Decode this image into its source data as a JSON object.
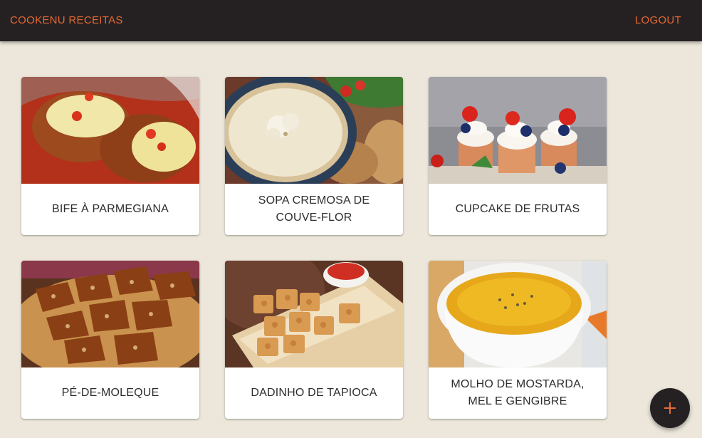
{
  "appbar": {
    "title": "COOKENU RECEITAS",
    "logout_label": "LOGOUT"
  },
  "recipes": [
    {
      "title": "BIFE À PARMEGIANA"
    },
    {
      "title": "SOPA CREMOSA DE COUVE-FLOR"
    },
    {
      "title": "CUPCAKE DE FRUTAS"
    },
    {
      "title": "PÉ-DE-MOLEQUE"
    },
    {
      "title": "DADINHO DE TAPIOCA"
    },
    {
      "title": "MOLHO DE MOSTARDA, MEL E GENGIBRE"
    }
  ],
  "fab": {
    "icon": "plus-icon"
  },
  "colors": {
    "appbar_bg": "#252122",
    "accent": "#e86a35",
    "page_bg": "#ece7da"
  }
}
